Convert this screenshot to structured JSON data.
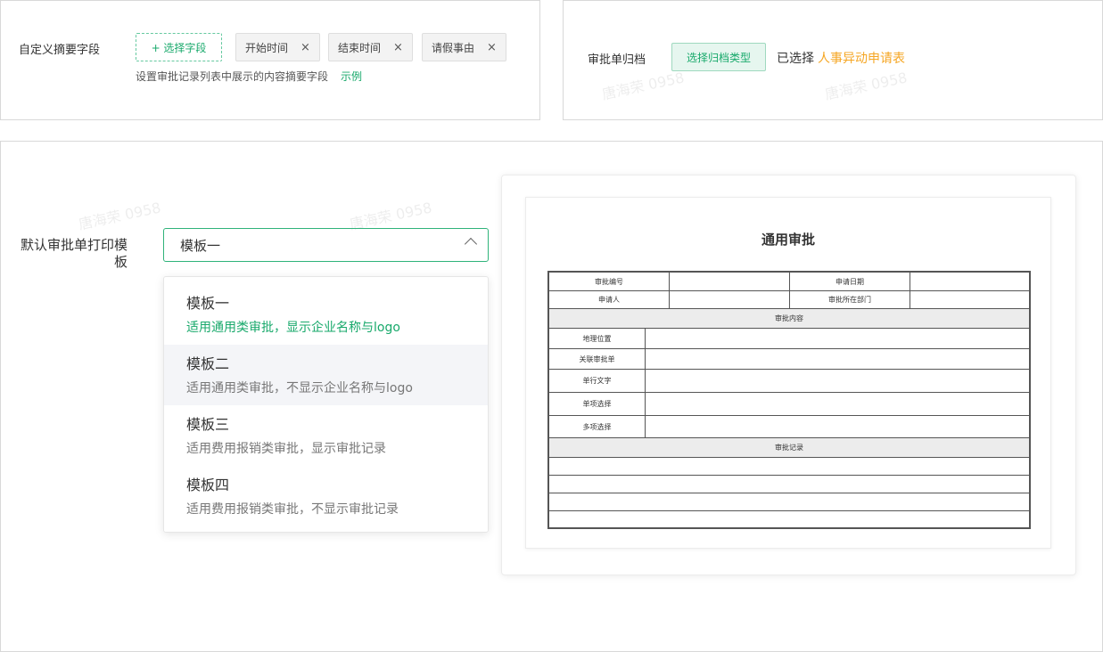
{
  "summary": {
    "label": "自定义摘要字段",
    "add_button": "+ 选择字段",
    "tags": [
      "开始时间",
      "结束时间",
      "请假事由"
    ],
    "remove_glyph": "×",
    "hint": "设置审批记录列表中展示的内容摘要字段",
    "example_link": "示例"
  },
  "archive": {
    "label": "审批单归档",
    "button": "选择归档类型",
    "selected_prefix": "已选择",
    "selected_value": "人事异动申请表"
  },
  "print": {
    "label": "默认审批单打印模板",
    "selected": "模板一",
    "options": [
      {
        "title": "模板一",
        "desc": "适用通用类审批，显示企业名称与logo"
      },
      {
        "title": "模板二",
        "desc": "适用通用类审批，不显示企业名称与logo"
      },
      {
        "title": "模板三",
        "desc": "适用费用报销类审批，显示审批记录"
      },
      {
        "title": "模板四",
        "desc": "适用费用报销类审批，不显示审批记录"
      }
    ]
  },
  "preview": {
    "title": "通用审批",
    "approval_no": "审批编号",
    "apply_date": "申请日期",
    "applicant": "申请人",
    "department": "审批所在部门",
    "content_header": "审批内容",
    "fields": [
      "地理位置",
      "关联审批单",
      "单行文字",
      "单项选择",
      "多项选择"
    ],
    "record_header": "审批记录"
  },
  "watermark": "唐海荣 0958",
  "colors": {
    "accent": "#18a96b",
    "highlight": "#f5a623"
  }
}
